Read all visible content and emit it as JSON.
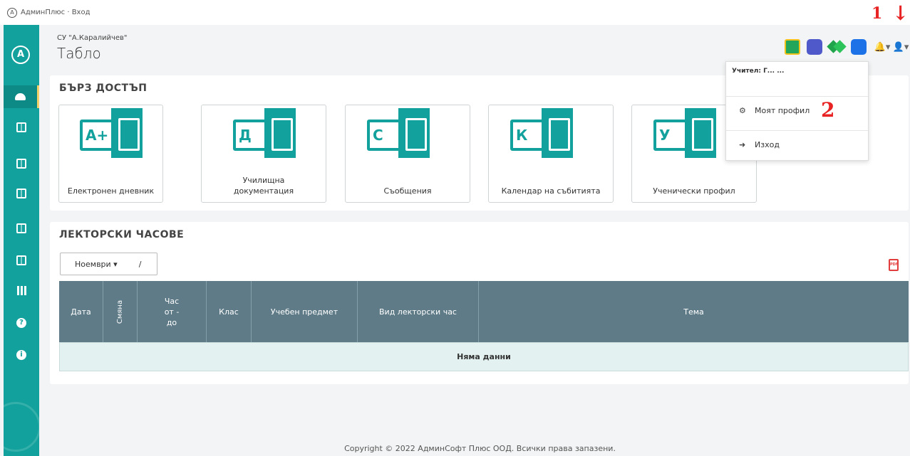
{
  "browser_tab": {
    "title": "АдминПлюс · Вход",
    "logo": "A"
  },
  "sidebar": {
    "logo": "A",
    "items": [
      {
        "icon": "dashboard-icon",
        "active": true
      },
      {
        "icon": "journal-icon"
      },
      {
        "icon": "documents-icon"
      },
      {
        "icon": "messages-icon"
      },
      {
        "icon": "calendar-icon"
      },
      {
        "icon": "profile-icon"
      },
      {
        "icon": "grid-icon"
      },
      {
        "icon": "help-icon",
        "glyph": "?"
      },
      {
        "icon": "info-icon",
        "glyph": "i"
      }
    ]
  },
  "header": {
    "school": "СУ \"А.Каралийчев\"",
    "title": "Табло",
    "bell": "🔔▾",
    "user": "👤▾"
  },
  "annotations": {
    "one": "1",
    "arrow": "↓",
    "two": "2"
  },
  "user_menu": {
    "header": "Учител: Г... ...",
    "items": [
      {
        "icon": "⚙",
        "label": "Моят профил"
      },
      {
        "icon": "➜",
        "label": "Изход"
      }
    ]
  },
  "quick_access": {
    "title": "БЪРЗ ДОСТЪП",
    "tiles": [
      {
        "letter": "A+",
        "label": "Електронен дневник"
      },
      {
        "letter": "Д",
        "label": "Училищна документация"
      },
      {
        "letter": "С",
        "label": "Съобщения"
      },
      {
        "letter": "К",
        "label": "Календар на събитията"
      },
      {
        "letter": "У",
        "label": "Ученически профил"
      }
    ]
  },
  "lecture_hours": {
    "title": "ЛЕКТОРСКИ ЧАСОВЕ",
    "month": "Ноември ▾",
    "slash": "/",
    "pdf": "PDF",
    "columns": [
      "Дата",
      "Смяна",
      "Час от - до",
      "Клас",
      "Учебен предмет",
      "Вид лекторски час",
      "Тема"
    ],
    "empty": "Няма данни"
  },
  "footer": {
    "text": "Copyright © 2022 АдминСофт Плюс ООД. Всички права запазени."
  },
  "colors": {
    "primary": "#12a19c",
    "table_header": "#5e7b87",
    "annotation": "#e82323"
  }
}
